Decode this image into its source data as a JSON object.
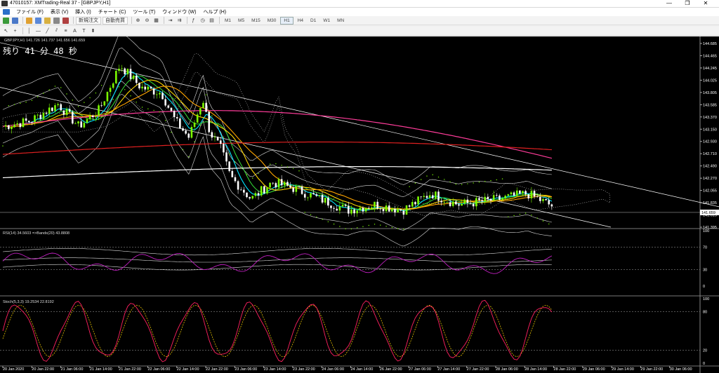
{
  "window": {
    "title": "47010157: XMTrading-Real 37 - [GBPJPY,H1]",
    "minimize": "—",
    "maximize": "❐",
    "close": "✕"
  },
  "menu": [
    "ファイル (F)",
    "表示 (V)",
    "挿入 (I)",
    "チャート (C)",
    "ツール (T)",
    "ウィンドウ (W)",
    "ヘルプ (H)"
  ],
  "toolbar": {
    "new_order": "新規注文",
    "auto_trading": "自動売買",
    "timeframes": [
      "M1",
      "M5",
      "M15",
      "M30",
      "H1",
      "H4",
      "D1",
      "W1",
      "MN"
    ],
    "active_timeframe": "H1"
  },
  "chart": {
    "header": "GBPJPY,H1  141.726 141.737 141.656 141.659",
    "countdown": "残り 41 分 48 秒",
    "current_price": "141.659",
    "price_ticks": [
      "144.685",
      "144.465",
      "144.245",
      "144.025",
      "143.805",
      "143.585",
      "143.370",
      "143.150",
      "142.930",
      "142.710",
      "142.490",
      "142.270",
      "142.055",
      "141.835",
      "141.615",
      "141.395"
    ],
    "time_ticks": [
      "20 Jan 2020",
      "20 Jan 22:00",
      "21 Jan 06:00",
      "21 Jan 14:00",
      "21 Jan 22:00",
      "22 Jan 06:00",
      "22 Jan 14:00",
      "22 Jan 22:00",
      "23 Jan 06:00",
      "23 Jan 14:00",
      "23 Jan 22:00",
      "24 Jan 06:00",
      "24 Jan 14:00",
      "26 Jan 22:00",
      "27 Jan 06:00",
      "27 Jan 14:00",
      "27 Jan 22:00",
      "28 Jan 06:00",
      "28 Jan 14:00",
      "28 Jan 22:00",
      "29 Jan 06:00",
      "29 Jan 14:00",
      "29 Jan 22:00",
      "30 Jan 06:00"
    ]
  },
  "rsi": {
    "label": "RSI(14) 34.5603  =>Bands(20) 43.8808",
    "ticks": [
      "100",
      "70",
      "30",
      "0"
    ]
  },
  "stoch": {
    "label": "Stoch(5,3,3) 19.2534 22.8192",
    "ticks": [
      "100",
      "80",
      "20",
      "0"
    ]
  },
  "colors": {
    "background": "#000000",
    "bull": "#7cfc00",
    "bear": "#ffffff",
    "ma_red": "#e02020",
    "ma_pink": "#ff3c9a",
    "ma_orange": "#ffa500",
    "ma_yellow": "#ffd700",
    "ma_green": "#32cd32",
    "ma_cyan": "#00e5ff",
    "ma_white": "#ffffff",
    "rsi_line": "#c020c0",
    "stoch_main": "#ff2060",
    "stoch_signal": "#ffd700"
  }
}
